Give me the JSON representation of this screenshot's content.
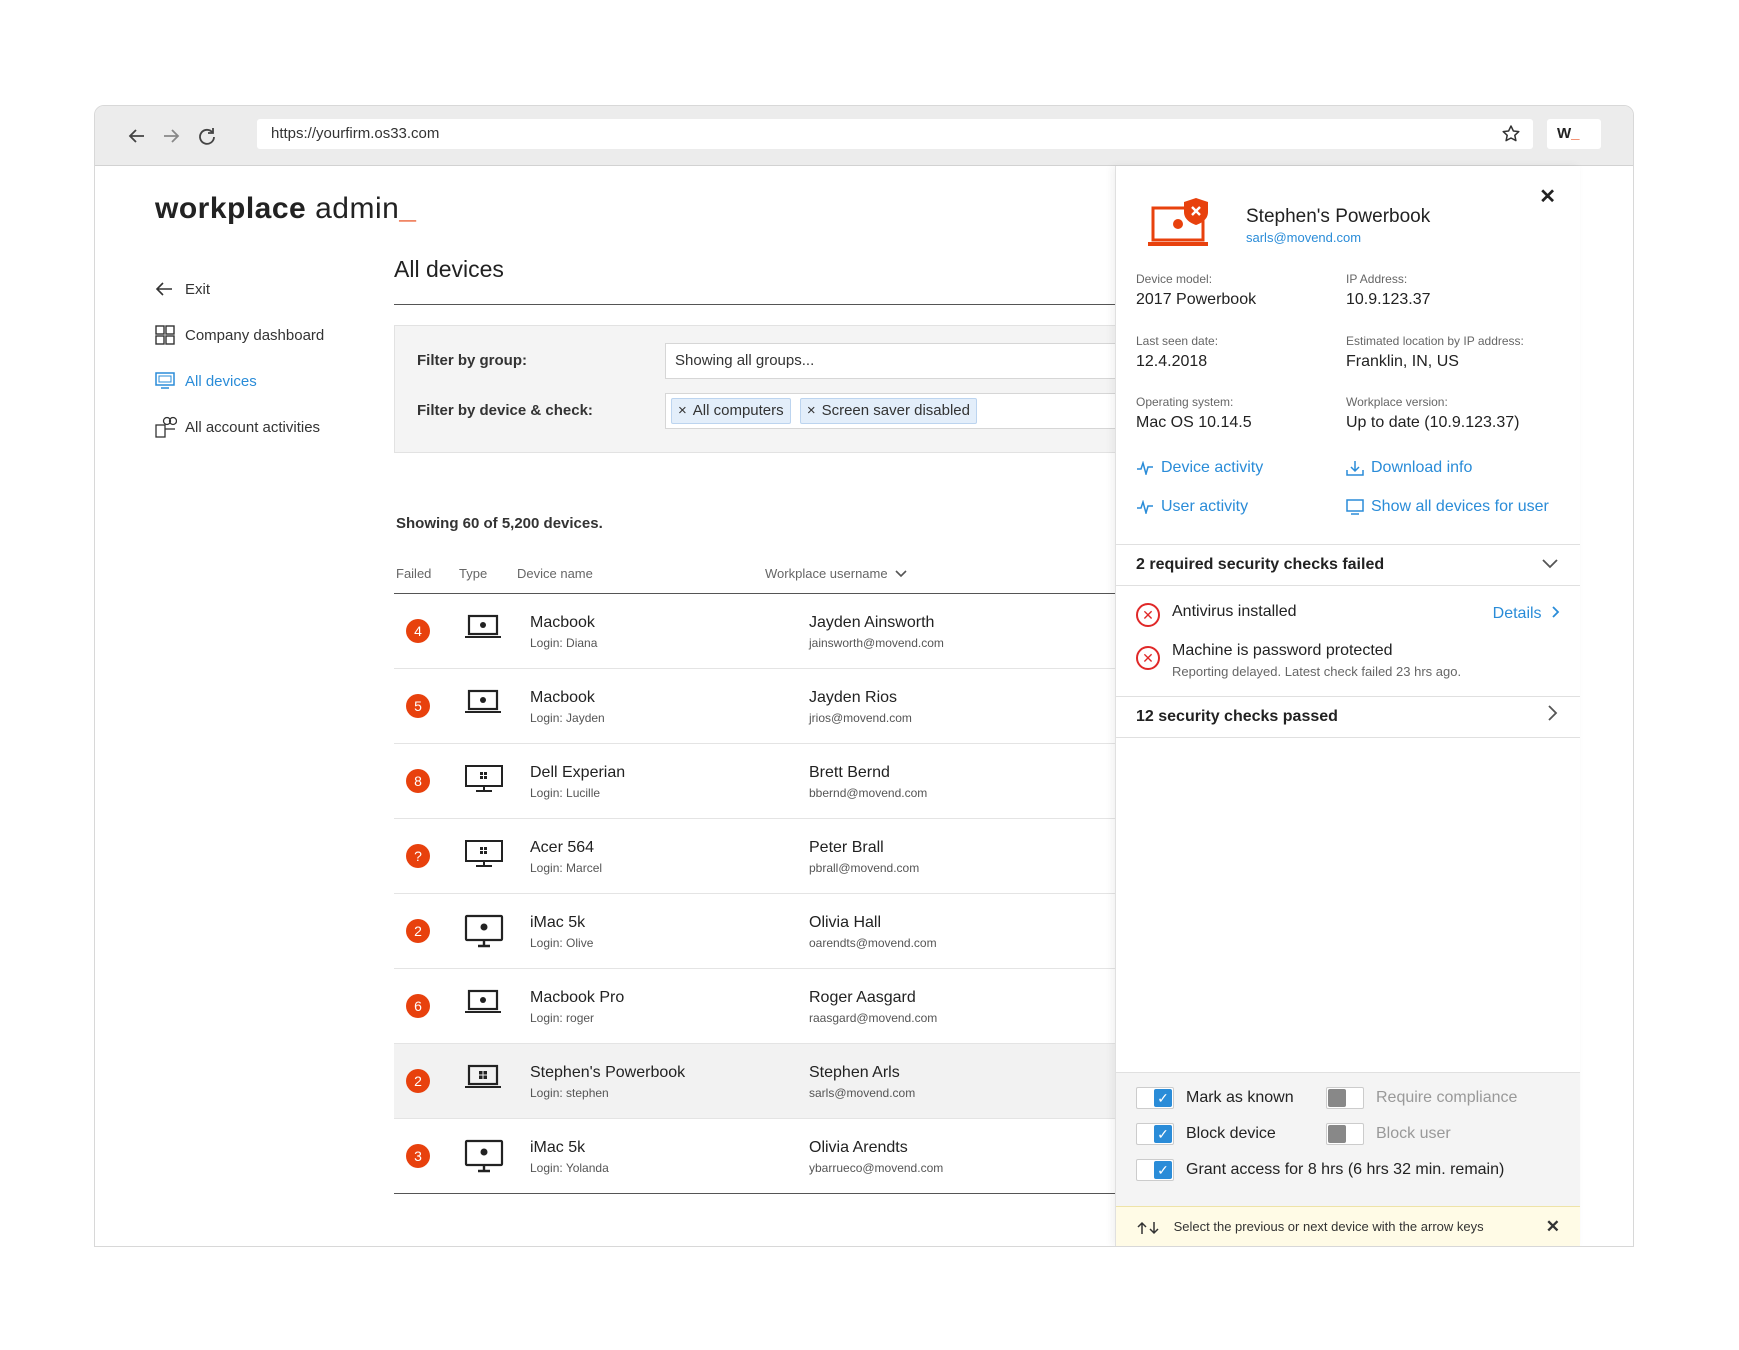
{
  "browser": {
    "url": "https://yourfirm.os33.com",
    "extension_label": "W",
    "extension_mark": "_"
  },
  "app": {
    "logo_bold": "workplace",
    "logo_light": "admin",
    "logo_mark": "_"
  },
  "sidebar": {
    "items": [
      {
        "label": "Exit",
        "icon": "arrow-left-icon"
      },
      {
        "label": "Company dashboard",
        "icon": "dashboard-grid-icon"
      },
      {
        "label": "All devices",
        "icon": "monitor-icon",
        "active": true
      },
      {
        "label": "All account activities",
        "icon": "activities-icon"
      }
    ]
  },
  "main": {
    "title": "All devices",
    "filters": {
      "group_label": "Filter by group:",
      "group_value": "Showing all groups...",
      "device_label": "Filter by device & check:",
      "chips": [
        "All computers",
        "Screen saver disabled"
      ]
    },
    "count_text": "Showing 60 of 5,200 devices.",
    "columns": {
      "failed": "Failed",
      "type": "Type",
      "device": "Device name",
      "user": "Workplace username"
    },
    "rows": [
      {
        "failed": "4",
        "type": "laptop-apple",
        "device": "Macbook",
        "login": "Login: Diana",
        "user": "Jayden Ainsworth",
        "email": "jainsworth@movend.com"
      },
      {
        "failed": "5",
        "type": "laptop-apple",
        "device": "Macbook",
        "login": "Login: Jayden",
        "user": "Jayden Rios",
        "email": "jrios@movend.com"
      },
      {
        "failed": "8",
        "type": "desktop-windows",
        "device": "Dell Experian",
        "login": "Login: Lucille",
        "user": "Brett Bernd",
        "email": "bbernd@movend.com"
      },
      {
        "failed": "?",
        "type": "desktop-windows",
        "device": "Acer 564",
        "login": "Login: Marcel",
        "user": "Peter Brall",
        "email": "pbrall@movend.com"
      },
      {
        "failed": "2",
        "type": "imac-apple",
        "device": "iMac 5k",
        "login": "Login: Olive",
        "user": "Olivia Hall",
        "email": "oarendts@movend.com"
      },
      {
        "failed": "6",
        "type": "laptop-apple",
        "device": "Macbook Pro",
        "login": "Login: roger",
        "user": "Roger Aasgard",
        "email": "raasgard@movend.com"
      },
      {
        "failed": "2",
        "type": "laptop-windows",
        "device": "Stephen's Powerbook",
        "login": "Login: stephen",
        "user": "Stephen Arls",
        "email": "sarls@movend.com",
        "selected": true
      },
      {
        "failed": "3",
        "type": "imac-apple",
        "device": "iMac 5k",
        "login": "Login: Yolanda",
        "user": "Olivia Arendts",
        "email": "ybarrueco@movend.com"
      }
    ]
  },
  "panel": {
    "device_name": "Stephen's Powerbook",
    "user_email": "sarls@movend.com",
    "info": [
      {
        "key": "Device model:",
        "value": "2017 Powerbook"
      },
      {
        "key": "IP Address:",
        "value": "10.9.123.37"
      },
      {
        "key": "Last seen date:",
        "value": "12.4.2018"
      },
      {
        "key": "Estimated location by IP address:",
        "value": "Franklin, IN, US"
      },
      {
        "key": "Operating system:",
        "value": "Mac OS 10.14.5"
      },
      {
        "key": "Workplace version:",
        "value": "Up to date (10.9.123.37)"
      }
    ],
    "links": {
      "device_activity": "Device activity",
      "download_info": "Download info",
      "user_activity": "User activity",
      "show_all_devices": "Show all devices for user"
    },
    "failed_header": "2 required security checks failed",
    "failed_checks": [
      {
        "title": "Antivirus installed",
        "details": "Details"
      },
      {
        "title": "Machine is password protected",
        "sub": "Reporting delayed. Latest check failed 23 hrs ago."
      }
    ],
    "passed_header": "12 security checks passed",
    "toggles": {
      "mark_known": "Mark as known",
      "require_compliance": "Require compliance",
      "block_device": "Block device",
      "block_user": "Block user",
      "grant_access": "Grant access for 8 hrs (6 hrs 32 min. remain)"
    },
    "hint": "Select the previous or next device with the arrow keys",
    "colors": {
      "accent": "#2a8cd8",
      "alert": "#e8410d",
      "fail": "#e02828"
    }
  }
}
